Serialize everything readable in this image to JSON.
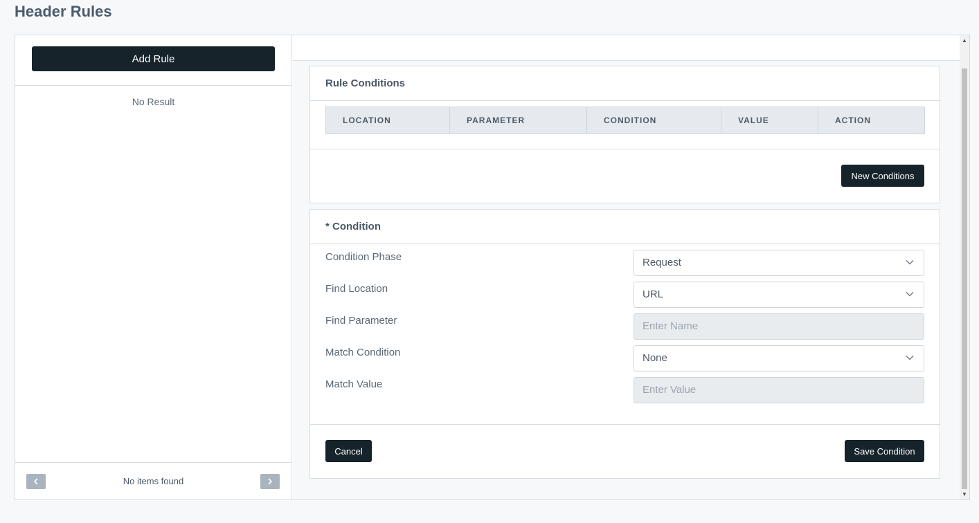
{
  "page": {
    "title": "Header Rules"
  },
  "sidebar": {
    "add_rule_label": "Add Rule",
    "empty_text": "No Result",
    "pagination_text": "No items found"
  },
  "rule_conditions": {
    "title": "Rule Conditions",
    "columns": [
      "LOCATION",
      "PARAMETER",
      "CONDITION",
      "VALUE",
      "ACTION"
    ],
    "new_button": "New Conditions"
  },
  "condition_form": {
    "title": "* Condition",
    "fields": [
      {
        "label": "Condition Phase",
        "value": "Request",
        "type": "select"
      },
      {
        "label": "Find Location",
        "value": "URL",
        "type": "select"
      },
      {
        "label": "Find Parameter",
        "placeholder": "Enter Name",
        "type": "input"
      },
      {
        "label": "Match Condition",
        "value": "None",
        "type": "select"
      },
      {
        "label": "Match Value",
        "placeholder": "Enter Value",
        "type": "input"
      }
    ],
    "cancel_label": "Cancel",
    "save_label": "Save Condition"
  },
  "icons": {
    "prev": "chevron-left-icon",
    "next": "chevron-right-icon",
    "dropdown": "chevron-down-icon"
  },
  "colors": {
    "primary_button": "#16232b",
    "background": "#f6f8fa",
    "border": "#d7dce2"
  }
}
